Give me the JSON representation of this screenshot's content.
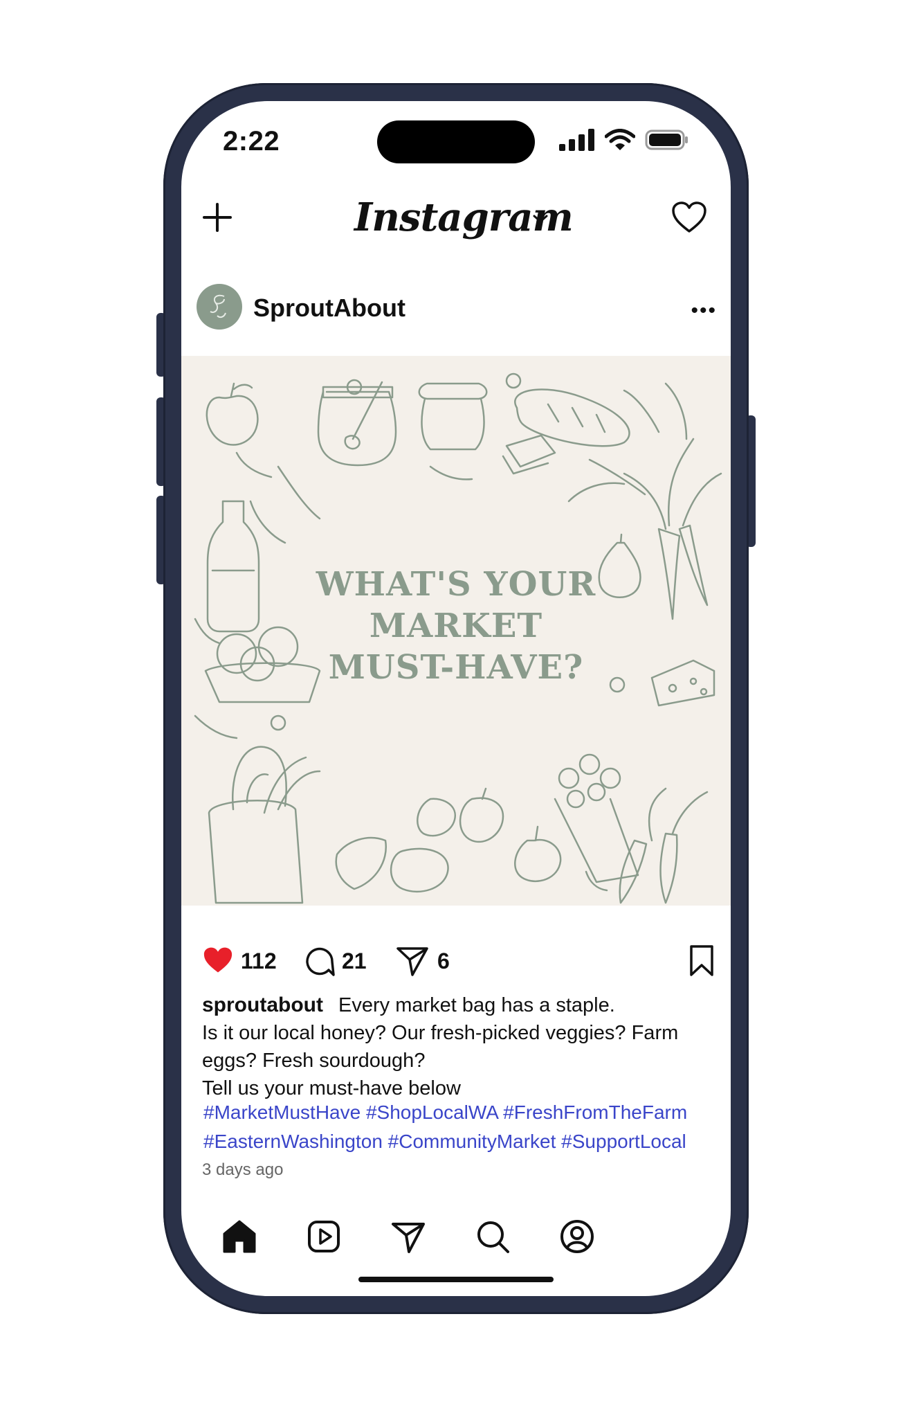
{
  "status_bar": {
    "time": "2:22"
  },
  "app": {
    "title": "Instagram"
  },
  "post": {
    "account_name": "SproutAbout",
    "image_title_lines": [
      "WHAT'S YOUR",
      "MARKET",
      "MUST-HAVE?"
    ],
    "likes": "112",
    "comments": "21",
    "shares": "6",
    "caption_username": "sproutabout",
    "caption_lines": [
      "Every market bag has a staple.",
      "Is it our local honey? Our fresh-picked veggies? Farm eggs? Fresh sourdough?",
      "Tell us your must-have below"
    ],
    "hashtags_line1": "#MarketMustHave #ShopLocalWA #FreshFromTheFarm",
    "hashtags_line2": "#EasternWashington #CommunityMarket #SupportLocal",
    "time_ago": "3 days ago"
  },
  "colors": {
    "sage": "#8a9b8c",
    "background_cream": "#f4f0ea",
    "like_red": "#e8202a",
    "hashtag_blue": "#3a45c9",
    "phone_frame": "#2a3148"
  },
  "icons": [
    "plus-icon",
    "chevron-down-icon",
    "heart-icon",
    "more-icon",
    "like-heart-icon",
    "comment-icon",
    "share-icon",
    "bookmark-icon",
    "home-icon",
    "reels-icon",
    "send-icon",
    "search-icon",
    "profile-icon"
  ]
}
